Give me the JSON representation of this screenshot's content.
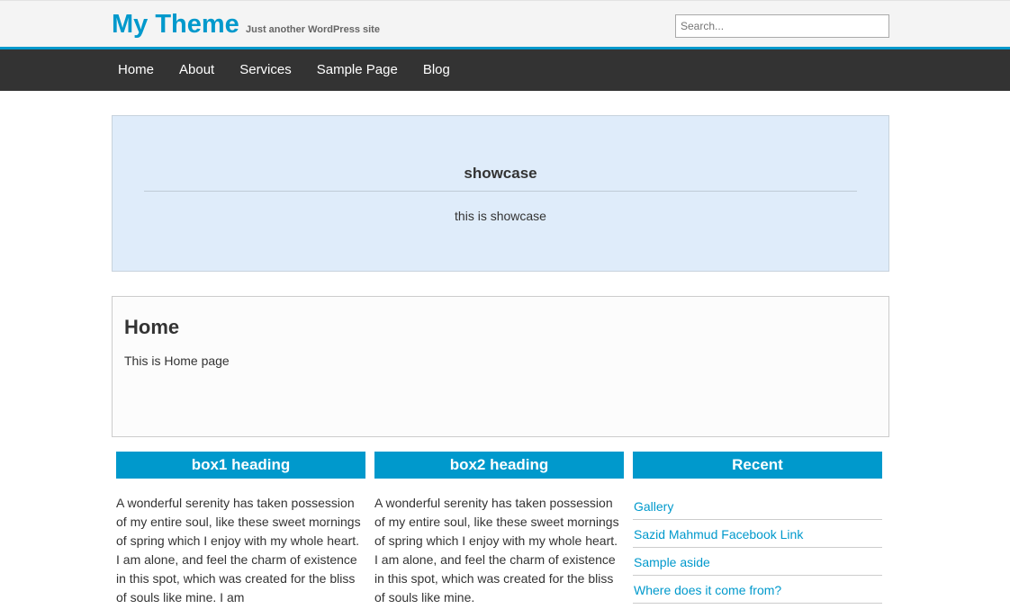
{
  "header": {
    "site_title": "My Theme",
    "tagline": "Just another WordPress site",
    "search_placeholder": "Search...",
    "colors": {
      "brand": "#0099cc",
      "nav_bg": "#333333",
      "header_bg": "#f4f4f4"
    }
  },
  "nav": {
    "items": [
      {
        "label": "Home"
      },
      {
        "label": "About"
      },
      {
        "label": "Services"
      },
      {
        "label": "Sample Page"
      },
      {
        "label": "Blog"
      }
    ]
  },
  "showcase": {
    "title": "showcase",
    "text": "this is showcase"
  },
  "main": {
    "title": "Home",
    "body": "This is Home page"
  },
  "boxes": [
    {
      "heading": "box1 heading",
      "text": "A wonderful serenity has taken possession of my entire soul, like these sweet mornings of spring which I enjoy with my whole heart. I am alone, and feel the charm of existence in this spot, which was created for the bliss of souls like mine. I am"
    },
    {
      "heading": "box2 heading",
      "text": "A wonderful serenity has taken possession of my entire soul, like these sweet mornings of spring which I enjoy with my whole heart. I am alone, and feel the charm of existence in this spot, which was created for the bliss of souls like mine."
    }
  ],
  "recent": {
    "heading": "Recent",
    "items": [
      {
        "label": "Gallery"
      },
      {
        "label": "Sazid Mahmud Facebook Link"
      },
      {
        "label": "Sample aside"
      },
      {
        "label": "Where does it come from?"
      }
    ]
  }
}
